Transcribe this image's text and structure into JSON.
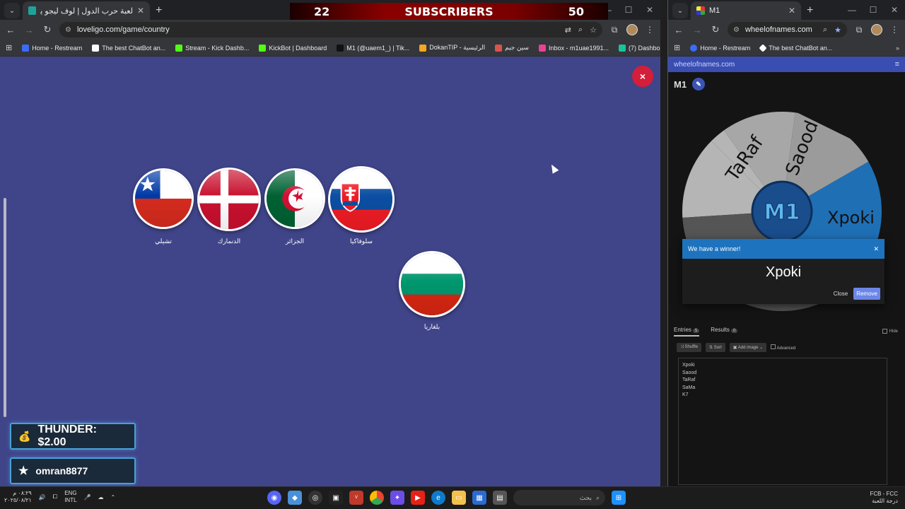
{
  "left_window": {
    "tab_title": "لعبة حرب الدول | لوف ليجو يوفر",
    "url": "loveligo.com/game/country",
    "bookmarks": [
      {
        "label": "Home - Restream",
        "color": "#3b6cf6"
      },
      {
        "label": "The best ChatBot an...",
        "color": "#ffffff"
      },
      {
        "label": "Stream - Kick Dashb...",
        "color": "#53fc18"
      },
      {
        "label": "KickBot | Dashboard",
        "color": "#53fc18"
      },
      {
        "label": "M1 (@uaem1_) | Tik...",
        "color": "#111111"
      },
      {
        "label": "DokanTIP - الرئيسية",
        "color": "#f5a623"
      },
      {
        "label": "سين جيم",
        "color": "#d9534f"
      },
      {
        "label": "Inbox - m1uae1991...",
        "color": "#e84393"
      },
      {
        "label": "(7) Dashboard / Stre...",
        "color": "#19c39c"
      }
    ],
    "flags": [
      {
        "name": "تشيلي",
        "icon": "chile-flag"
      },
      {
        "name": "الدنمارك",
        "icon": "denmark-flag"
      },
      {
        "name": "الجزائر",
        "icon": "algeria-flag"
      },
      {
        "name": "سلوفاكيا",
        "icon": "slovakia-flag"
      },
      {
        "name": "بلغاريا",
        "icon": "bulgaria-flag"
      }
    ],
    "close_label": "×"
  },
  "overlay": {
    "subs_current": "22",
    "subs_label": "SUBSCRIBERS",
    "subs_goal": "50",
    "alert_tip": "THUNDER: $2.00",
    "alert_follower": "omran8877"
  },
  "right_window": {
    "tab_title": "M1",
    "url": "wheelofnames.com",
    "bookmarks": [
      {
        "label": "Home - Restream"
      },
      {
        "label": "The best ChatBot an..."
      }
    ],
    "site_header": "wheelofnames.com",
    "wheel_name": "M1",
    "wheel_labels": [
      "TaRaf",
      "Saood",
      "Xpoki"
    ],
    "wheel_logo": "M1",
    "winner_title": "We have a winner!",
    "winner_name": "Xpoki",
    "close_label": "Close",
    "remove_label": "Remove",
    "tabs": [
      {
        "label": "Entries",
        "count": "5"
      },
      {
        "label": "Results",
        "count": "0"
      }
    ],
    "hide_label": "Hide",
    "tools": [
      "Shuffle",
      "Sort",
      "Add image"
    ],
    "advanced_label": "Advanced",
    "entries": [
      "Xpoki",
      "Saood",
      "TaRaf",
      "SaMa",
      "K7"
    ]
  },
  "taskbar": {
    "time": "٠٨:٢٩ م",
    "date": "٢٠٢٥/٠٨/٢١",
    "lang_1": "ENG",
    "lang_2": "INTL",
    "search_placeholder": "بحث",
    "weather_1": "FCB - FCC",
    "weather_2": "درجة اللعبة"
  }
}
